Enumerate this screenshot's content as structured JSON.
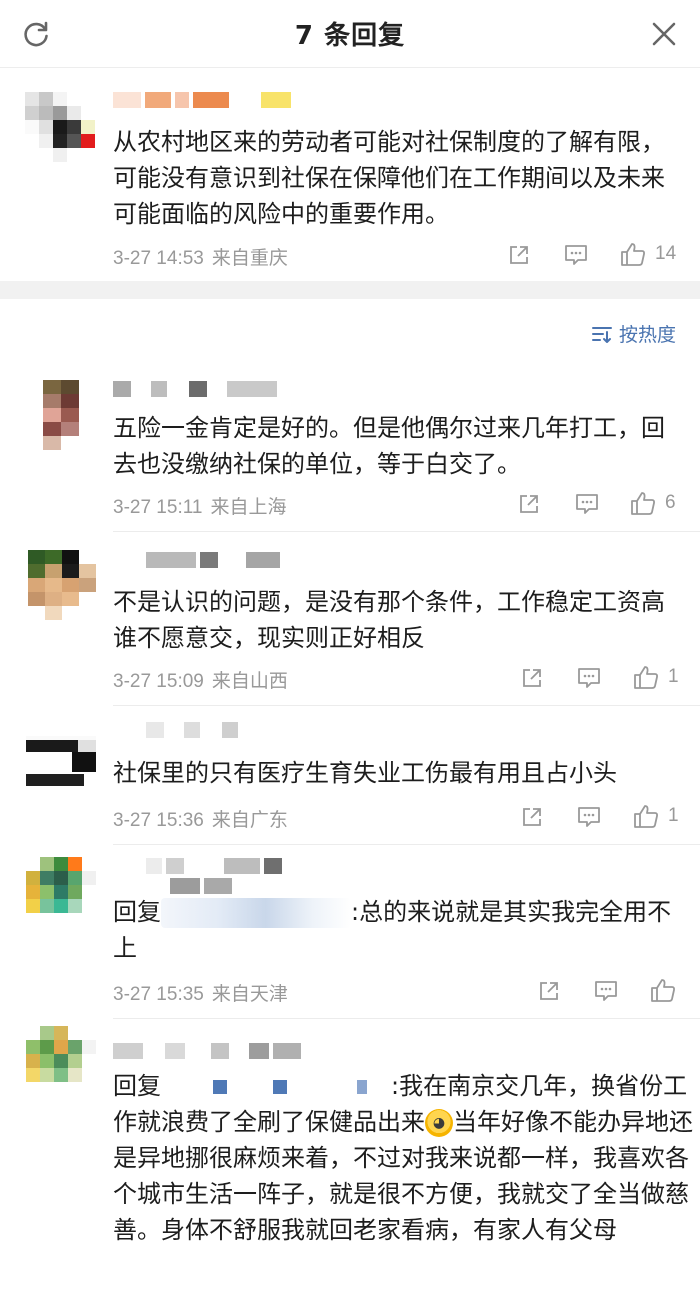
{
  "header": {
    "title": "7 条回复",
    "refresh_icon": "refresh-icon",
    "close_icon": "close-icon"
  },
  "root_comment": {
    "text": "从农村地区来的劳动者可能对社保制度的了解有限，可能没有意识到社保在保障他们在工作期间以及未来可能面临的风险中的重要作用。",
    "date": "3-27 14:53",
    "source": "来自重庆",
    "likes": "14"
  },
  "sort": {
    "label": "按热度",
    "icon": "sort-icon"
  },
  "replies": [
    {
      "text": "五险一金肯定是好的。但是他偶尔过来几年打工，回去也没缴纳社保的单位，等于白交了。",
      "date": "3-27 15:11",
      "source": "来自上海",
      "likes": "6"
    },
    {
      "text": "不是认识的问题，是没有那个条件，工作稳定工资高谁不愿意交，现实则正好相反",
      "date": "3-27 15:09",
      "source": "来自山西",
      "likes": "1"
    },
    {
      "text": "社保里的只有医疗生育失业工伤最有用且占小头",
      "date": "3-27 15:36",
      "source": "来自广东",
      "likes": "1"
    },
    {
      "prefix": "回复",
      "text": ":总的来说就是其实我完全用不上",
      "date": "3-27 15:35",
      "source": "来自天津",
      "likes": ""
    },
    {
      "prefix": "回复",
      "text_a": ":我在南京交几年，换省份工作就浪费了全刷了保健品出来",
      "text_b": "当年好像不能办异地还是异地挪很麻烦来着，不过对我来说都一样，我喜欢各个城市生活一阵子，就是很不方便，我就交了全当做慈善。身体不舒服我就回老家看病，有家人有父母"
    }
  ],
  "colors": {
    "link": "#4a74b0",
    "meta": "#999999",
    "gap": "#f1f1f1"
  }
}
